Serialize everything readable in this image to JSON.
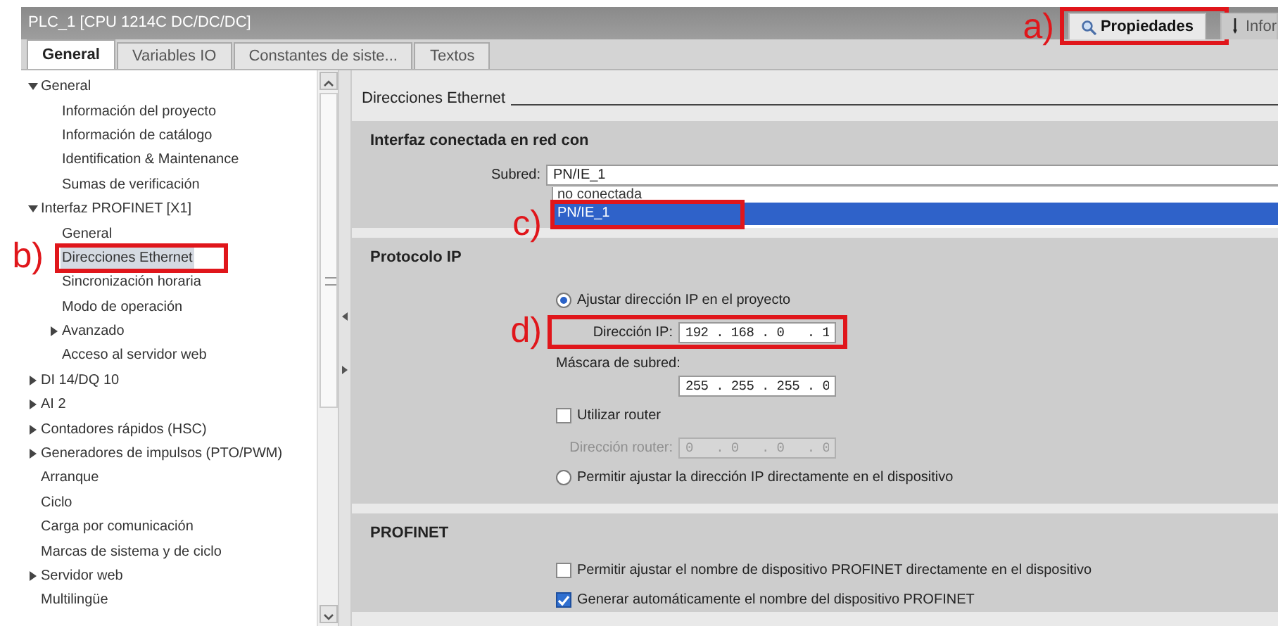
{
  "window": {
    "title": "PLC_1 [CPU 1214C DC/DC/DC]"
  },
  "inspector_tabs": [
    {
      "label": "Propiedades",
      "selected": true,
      "annotation": "a)"
    },
    {
      "label": "Infor",
      "selected": false
    }
  ],
  "tabs": [
    {
      "label": "General",
      "selected": true
    },
    {
      "label": "Variables IO",
      "selected": false
    },
    {
      "label": "Constantes de siste...",
      "selected": false
    },
    {
      "label": "Textos",
      "selected": false
    }
  ],
  "tree": [
    {
      "label": "General",
      "expanded": true,
      "selected": false,
      "children": [
        {
          "label": "Información del proyecto",
          "selected": false
        },
        {
          "label": "Información de catálogo",
          "selected": false
        },
        {
          "label": "Identification & Maintenance",
          "selected": false
        },
        {
          "label": "Sumas de verificación",
          "selected": false
        }
      ]
    },
    {
      "label": "Interfaz PROFINET [X1]",
      "expanded": true,
      "selected": false,
      "children": [
        {
          "label": "General",
          "selected": false
        },
        {
          "label": "Direcciones Ethernet",
          "selected": true,
          "annotation": "b)"
        },
        {
          "label": "Sincronización horaria",
          "selected": false
        },
        {
          "label": "Modo de operación",
          "selected": false
        },
        {
          "label": "Avanzado",
          "expanded": false,
          "selected": false
        },
        {
          "label": "Acceso al servidor web",
          "selected": false
        }
      ]
    },
    {
      "label": "DI 14/DQ 10",
      "expanded": false,
      "selected": false
    },
    {
      "label": "AI 2",
      "expanded": false,
      "selected": false
    },
    {
      "label": "Contadores rápidos (HSC)",
      "expanded": false,
      "selected": false
    },
    {
      "label": "Generadores de impulsos (PTO/PWM)",
      "expanded": false,
      "selected": false
    },
    {
      "label": "Arranque",
      "selected": false
    },
    {
      "label": "Ciclo",
      "selected": false
    },
    {
      "label": "Carga por comunicación",
      "selected": false
    },
    {
      "label": "Marcas de sistema y de ciclo",
      "selected": false
    },
    {
      "label": "Servidor web",
      "expanded": false,
      "selected": false
    },
    {
      "label": "Multilingüe",
      "selected": false
    }
  ],
  "content": {
    "heading": "Direcciones Ethernet",
    "sections": [
      {
        "title": "Interfaz conectada en red con",
        "rows": [
          {
            "kind": "dropdown",
            "label": "Subred:",
            "value": "PN/IE_1",
            "options": [
              {
                "label": "no conectada",
                "selected": false
              },
              {
                "label": "PN/IE_1",
                "selected": true,
                "annotation": "c)"
              }
            ]
          }
        ]
      },
      {
        "title": "Protocolo IP",
        "rows": [
          {
            "kind": "radio",
            "label": "Ajustar dirección IP en el proyecto",
            "checked": true
          },
          {
            "kind": "field",
            "label": "Dirección IP:",
            "value": "192 . 168 . 0   . 1",
            "disabled": false,
            "annotation": "d)"
          },
          {
            "kind": "field-stacked",
            "label": "Máscara de subred:",
            "value": "255 . 255 . 255 . 0",
            "disabled": false
          },
          {
            "kind": "checkbox",
            "label": "Utilizar router",
            "checked": false
          },
          {
            "kind": "field",
            "label": "Dirección router:",
            "value": "0   . 0   . 0   . 0",
            "disabled": true
          },
          {
            "kind": "radio",
            "label": "Permitir ajustar la dirección IP directamente en el dispositivo",
            "checked": false
          }
        ]
      },
      {
        "title": "PROFINET",
        "rows": [
          {
            "kind": "checkbox",
            "label": "Permitir ajustar el nombre de dispositivo PROFINET directamente en el dispositivo",
            "checked": false
          },
          {
            "kind": "checkbox",
            "label": "Generar automáticamente el nombre del dispositivo PROFINET",
            "checked": true
          }
        ]
      }
    ]
  }
}
